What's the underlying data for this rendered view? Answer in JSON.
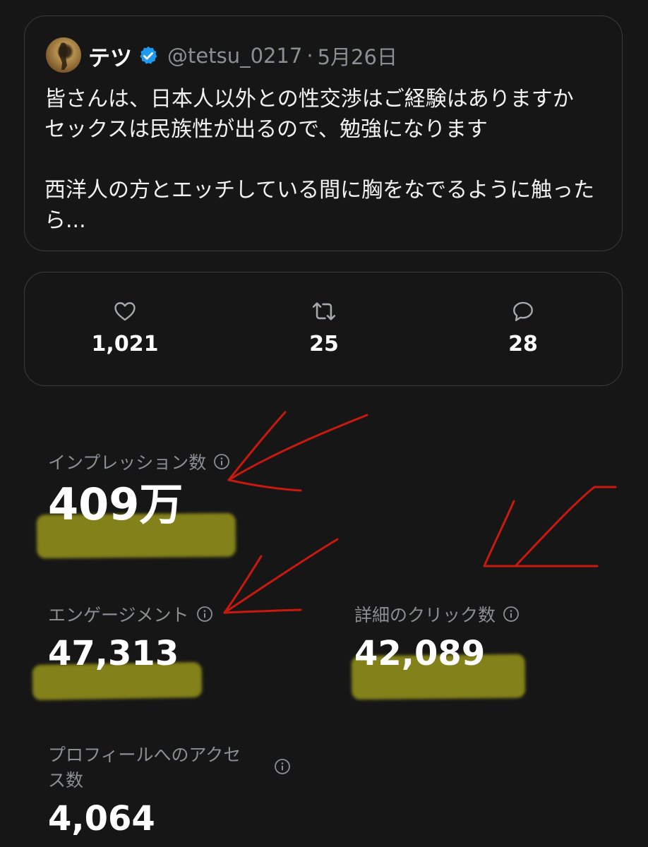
{
  "tweet": {
    "author_name": "テツ",
    "handle": "@tetsu_0217",
    "separator": "·",
    "date": "5月26日",
    "text": "皆さんは、日本人以外との性交渉はご経験はありますか\nセックスは民族性が出るので、勉強になります\n\n西洋人の方とエッチしている間に胸をなでるように触った\nら..."
  },
  "engagement_bar": {
    "likes": "1,021",
    "reposts": "25",
    "replies": "28"
  },
  "metrics": {
    "impressions_label": "インプレッション数",
    "impressions_value": "409万",
    "engagements_label": "エンゲージメント",
    "engagements_value": "47,313",
    "detail_clicks_label": "詳細のクリック数",
    "detail_clicks_value": "42,089",
    "profile_visits_label_line1": "プロフィールへのアクセ",
    "profile_visits_label_line2": "ス数",
    "profile_visits_value": "4,064"
  },
  "colors": {
    "background": "#161616",
    "card_border": "#3a3a3a",
    "verified_blue": "#1d9bf0",
    "annotation_red": "#c8190f",
    "highlighter_yellow": "#ddd91d"
  },
  "icons": [
    "verified-badge-icon",
    "heart-icon",
    "repost-icon",
    "reply-icon",
    "info-icon"
  ]
}
